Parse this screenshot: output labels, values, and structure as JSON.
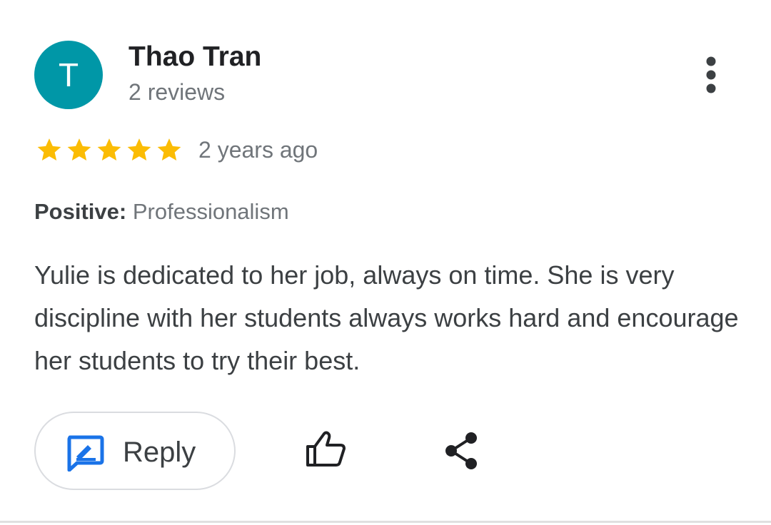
{
  "review": {
    "author": {
      "initial": "T",
      "name": "Thao Tran",
      "reviews_count": "2 reviews",
      "avatar_color": "#0097a7"
    },
    "more_icon": "more-vert-icon",
    "rating": {
      "stars": 5,
      "max_stars": 5,
      "star_color": "#fbbc04",
      "time_ago": "2 years ago"
    },
    "attribute": {
      "label": "Positive:",
      "value": "Professionalism"
    },
    "text": "Yulie is dedicated to her job, always on time. She is very discipline with her students always works hard and encourage her students to try their best.",
    "actions": {
      "reply_label": "Reply",
      "reply_icon": "reply-review-icon",
      "reply_icon_color": "#1a73e8",
      "like_icon": "thumb-up-icon",
      "share_icon": "share-icon"
    }
  }
}
